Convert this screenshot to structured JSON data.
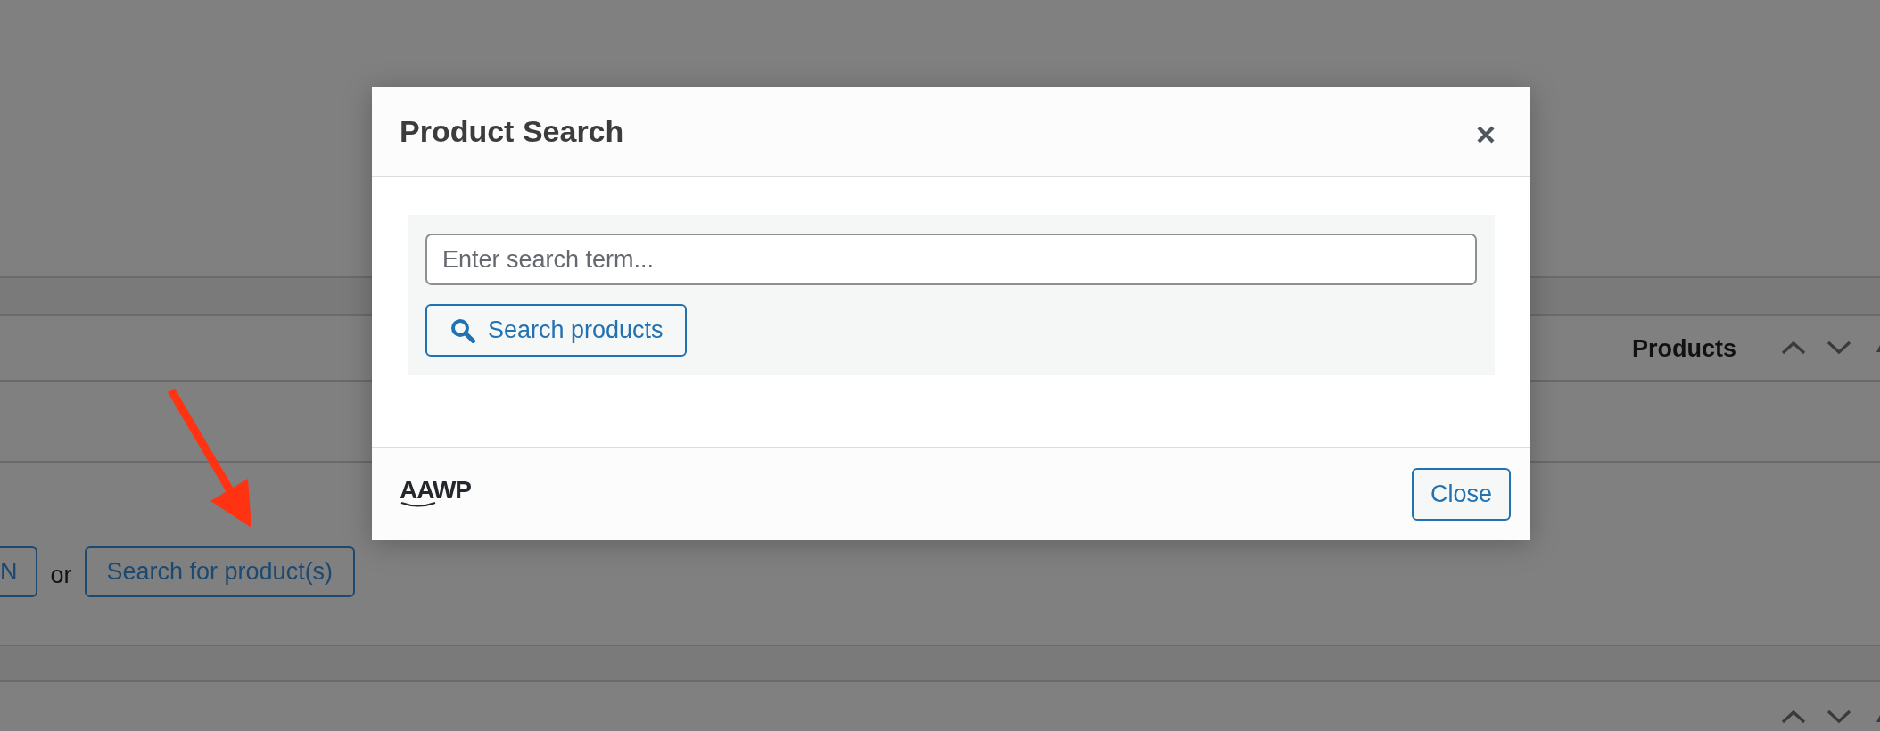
{
  "background": {
    "section_title": "Products",
    "buttons": [
      {
        "label": "N"
      },
      {
        "label": "Search for product(s)"
      }
    ],
    "separator": "or"
  },
  "modal": {
    "title": "Product Search",
    "search": {
      "placeholder": "Enter search term..."
    },
    "search_button": "Search products",
    "logo": "AAWP",
    "close_button": "Close"
  }
}
